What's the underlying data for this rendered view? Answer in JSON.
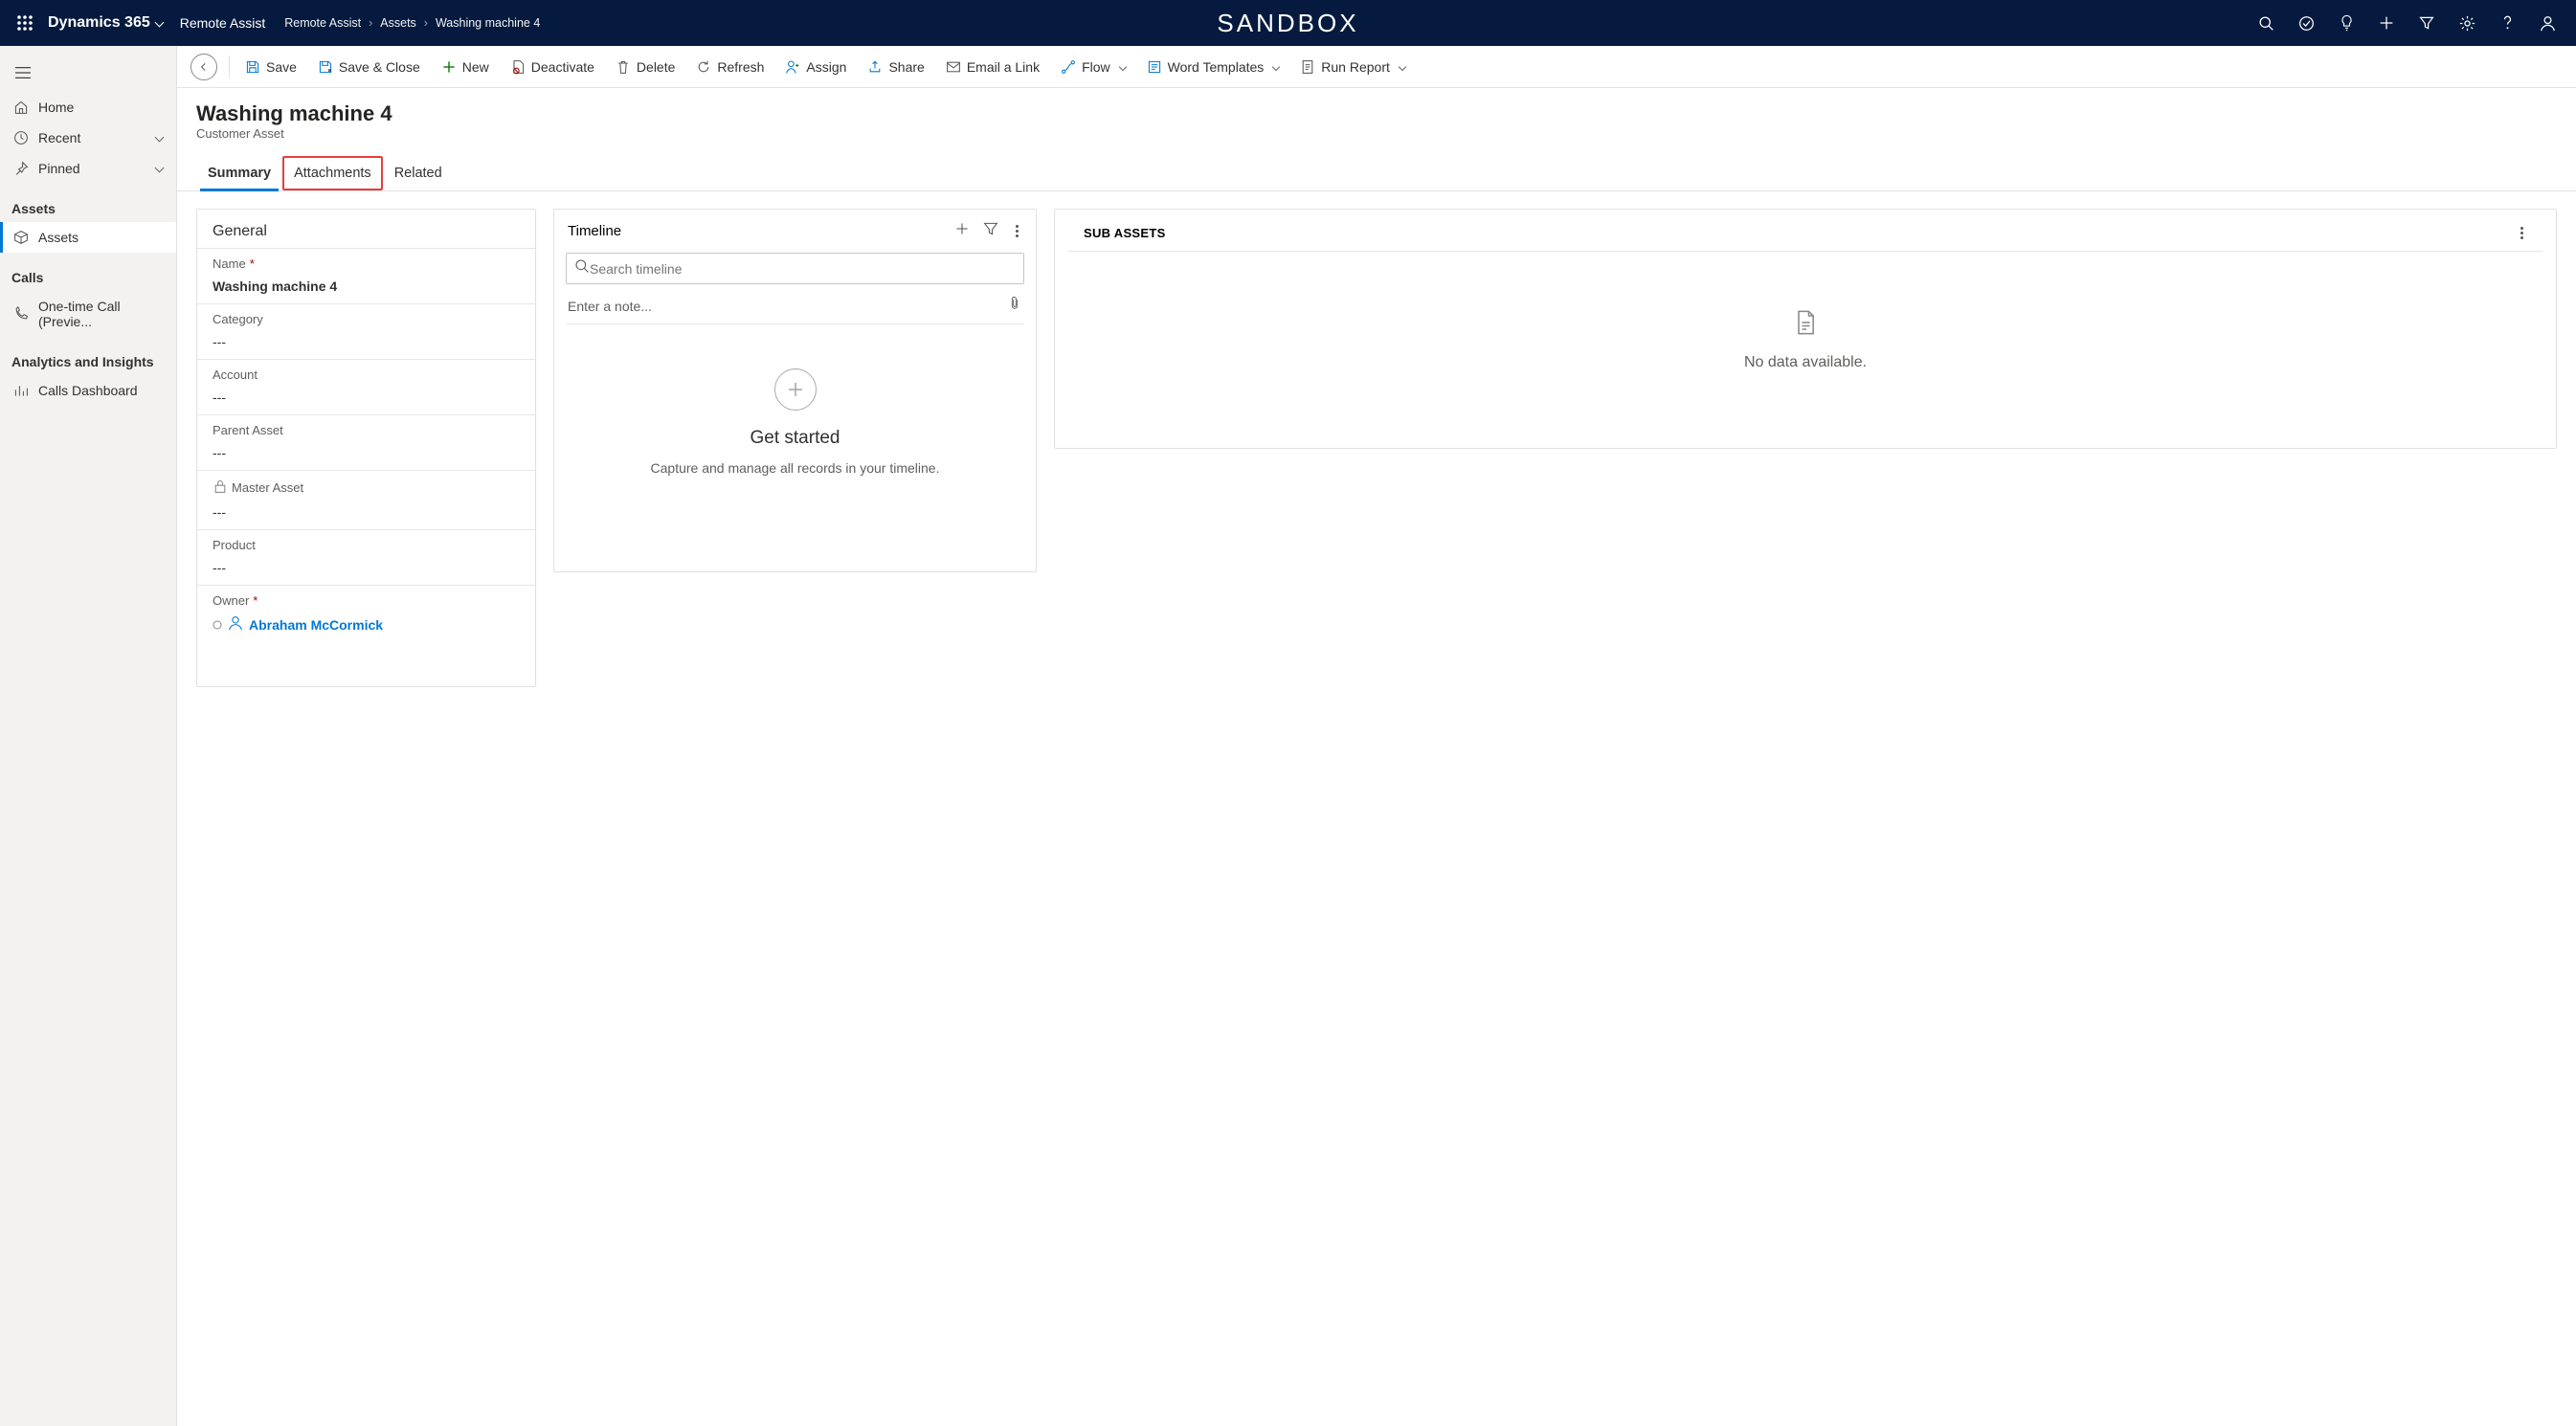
{
  "nav": {
    "app_name": "Dynamics 365",
    "module_name": "Remote Assist",
    "breadcrumb": [
      "Remote Assist",
      "Assets",
      "Washing machine 4"
    ],
    "env_badge": "SANDBOX"
  },
  "sidebar": {
    "home": "Home",
    "recent": "Recent",
    "pinned": "Pinned",
    "groups": [
      {
        "header": "Assets",
        "items": [
          {
            "label": "Assets",
            "selected": true
          }
        ]
      },
      {
        "header": "Calls",
        "items": [
          {
            "label": "One-time Call (Previe...",
            "selected": false
          }
        ]
      },
      {
        "header": "Analytics and Insights",
        "items": [
          {
            "label": "Calls Dashboard",
            "selected": false
          }
        ]
      }
    ]
  },
  "commands": {
    "save": "Save",
    "save_close": "Save & Close",
    "new": "New",
    "deactivate": "Deactivate",
    "delete": "Delete",
    "refresh": "Refresh",
    "assign": "Assign",
    "share": "Share",
    "email_link": "Email a Link",
    "flow": "Flow",
    "word_templates": "Word Templates",
    "run_report": "Run Report"
  },
  "page": {
    "title": "Washing machine  4",
    "subtitle": "Customer Asset",
    "tabs": {
      "summary": "Summary",
      "attachments": "Attachments",
      "related": "Related"
    }
  },
  "general": {
    "header": "General",
    "fields": {
      "name": {
        "label": "Name",
        "value": "Washing machine  4",
        "required": true
      },
      "category": {
        "label": "Category",
        "value": "---"
      },
      "account": {
        "label": "Account",
        "value": "---"
      },
      "parent_asset": {
        "label": "Parent Asset",
        "value": "---"
      },
      "master_asset": {
        "label": "Master Asset",
        "value": "---",
        "locked": true
      },
      "product": {
        "label": "Product",
        "value": "---"
      },
      "owner": {
        "label": "Owner",
        "value": "Abraham McCormick",
        "required": true,
        "is_link": true
      }
    }
  },
  "timeline": {
    "header": "Timeline",
    "search_placeholder": "Search timeline",
    "note_placeholder": "Enter a note...",
    "empty_title": "Get started",
    "empty_sub": "Capture and manage all records in your timeline."
  },
  "subassets": {
    "header": "SUB ASSETS",
    "empty_text": "No data available."
  }
}
